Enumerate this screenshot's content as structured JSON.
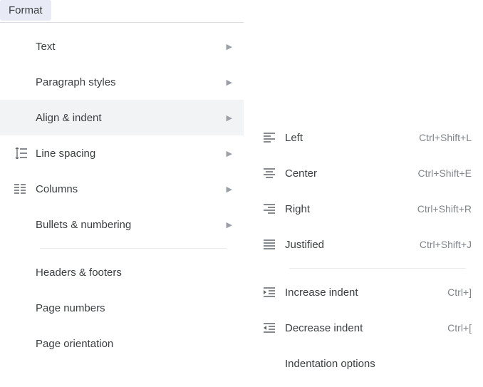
{
  "menu_button": {
    "label": "Format"
  },
  "main_menu": {
    "items": [
      {
        "label": "Text"
      },
      {
        "label": "Paragraph styles"
      },
      {
        "label": "Align & indent"
      },
      {
        "label": "Line spacing"
      },
      {
        "label": "Columns"
      },
      {
        "label": "Bullets & numbering"
      },
      {
        "label": "Headers & footers"
      },
      {
        "label": "Page numbers"
      },
      {
        "label": "Page orientation"
      }
    ]
  },
  "submenu": {
    "items": [
      {
        "label": "Left",
        "shortcut": "Ctrl+Shift+L"
      },
      {
        "label": "Center",
        "shortcut": "Ctrl+Shift+E"
      },
      {
        "label": "Right",
        "shortcut": "Ctrl+Shift+R"
      },
      {
        "label": "Justified",
        "shortcut": "Ctrl+Shift+J"
      },
      {
        "label": "Increase indent",
        "shortcut": "Ctrl+]"
      },
      {
        "label": "Decrease indent",
        "shortcut": "Ctrl+["
      },
      {
        "label": "Indentation options"
      }
    ]
  }
}
